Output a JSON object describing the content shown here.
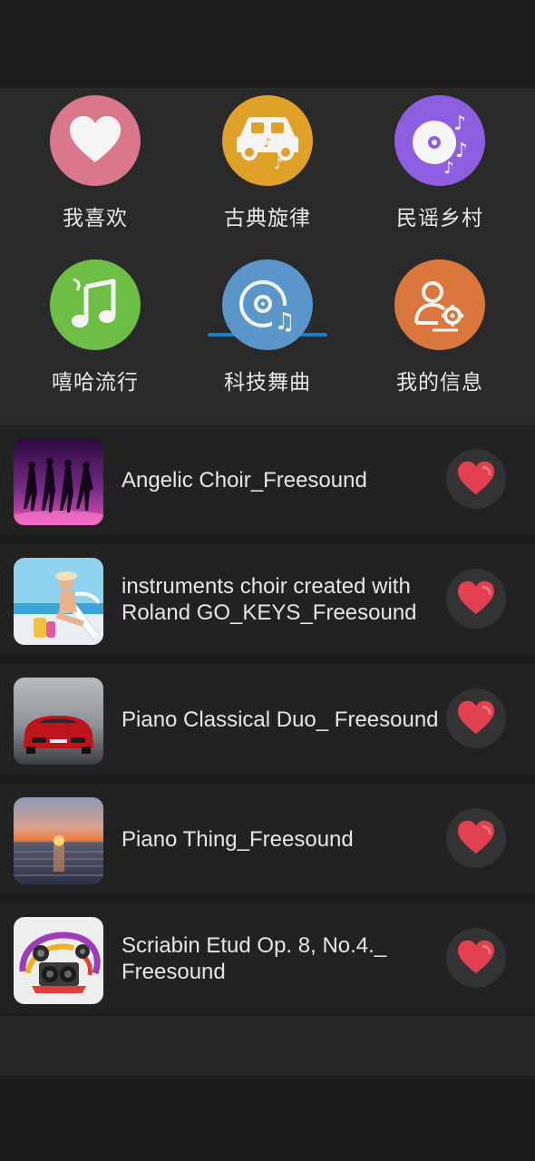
{
  "categories": [
    {
      "label": "我喜欢",
      "icon": "heart-icon",
      "color": "#d9778b"
    },
    {
      "label": "古典旋律",
      "icon": "car-music-icon",
      "color": "#e0a12a"
    },
    {
      "label": "民谣乡村",
      "icon": "disc-music-icon",
      "color": "#8d5ee0"
    },
    {
      "label": "嘻哈流行",
      "icon": "music-note-icon",
      "color": "#6ebd45"
    },
    {
      "label": "科技舞曲",
      "icon": "cd-music-icon",
      "color": "#5a96c9"
    },
    {
      "label": "我的信息",
      "icon": "user-settings-icon",
      "color": "#d9773d"
    }
  ],
  "selected_category": "古典旋律",
  "accent": "#1a7fc2",
  "tracks": [
    {
      "title": "Angelic Choir_Freesound",
      "thumb": "dancers-thumbnail"
    },
    {
      "title": "instruments choir created with Roland GO_KEYS_Freesound",
      "thumb": "beach-woman-thumbnail"
    },
    {
      "title": "Piano Classical Duo_ Freesound",
      "thumb": "red-sports-car-thumbnail"
    },
    {
      "title": "Piano Thing_Freesound",
      "thumb": "sunset-sea-thumbnail"
    },
    {
      "title": "Scriabin Etud Op. 8, No.4._ Freesound",
      "thumb": "speakers-music-thumbnail"
    }
  ],
  "like_icon": "heart-icon",
  "like_color": "#e0404f"
}
